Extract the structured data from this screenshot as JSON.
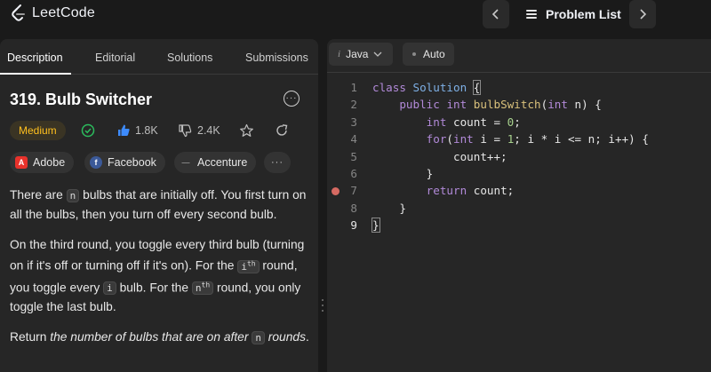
{
  "brand": {
    "name": "LeetCode"
  },
  "topbar": {
    "problem_list_label": "Problem List",
    "prev_icon": "chevron-left-icon",
    "next_icon": "chevron-right-icon"
  },
  "tabs": [
    {
      "label": "Description",
      "active": true
    },
    {
      "label": "Editorial",
      "active": false
    },
    {
      "label": "Solutions",
      "active": false
    },
    {
      "label": "Submissions",
      "active": false
    }
  ],
  "problem": {
    "title": "319. Bulb Switcher",
    "difficulty": "Medium",
    "likes": "1.8K",
    "dislikes": "2.4K",
    "companies": [
      "Adobe",
      "Facebook",
      "Accenture"
    ]
  },
  "description": {
    "p1_before": "There are",
    "p1_code": "n",
    "p1_after": "bulbs that are initially off. You first turn on all the bulbs, then you turn off every second bulb.",
    "p2_a": "On the third round, you toggle every third bulb (turning on if it's off or turning off if it's on). For the",
    "p2_code1": "i",
    "p2_sup1": "th",
    "p2_b": "round, you toggle every",
    "p2_code2": "i",
    "p2_c": "bulb. For the",
    "p2_code3": "n",
    "p2_sup3": "th",
    "p2_d": "round, you only toggle the last bulb.",
    "p3_a": "Return",
    "p3_em": "the number of bulbs that are on after",
    "p3_code": "n",
    "p3_em2": "rounds",
    "p3_end": "."
  },
  "editor": {
    "language": "Java",
    "language_prefix": "i",
    "mode": "Auto",
    "line_numbers": [
      "1",
      "2",
      "3",
      "4",
      "5",
      "6",
      "7",
      "8",
      "9"
    ],
    "breakpoint_line": 7,
    "current_line": 9
  },
  "colors": {
    "medium": "#ffc01e",
    "breakpoint": "#d66a62",
    "keyword": "#b28ad9",
    "type": "#7eb0e6"
  }
}
